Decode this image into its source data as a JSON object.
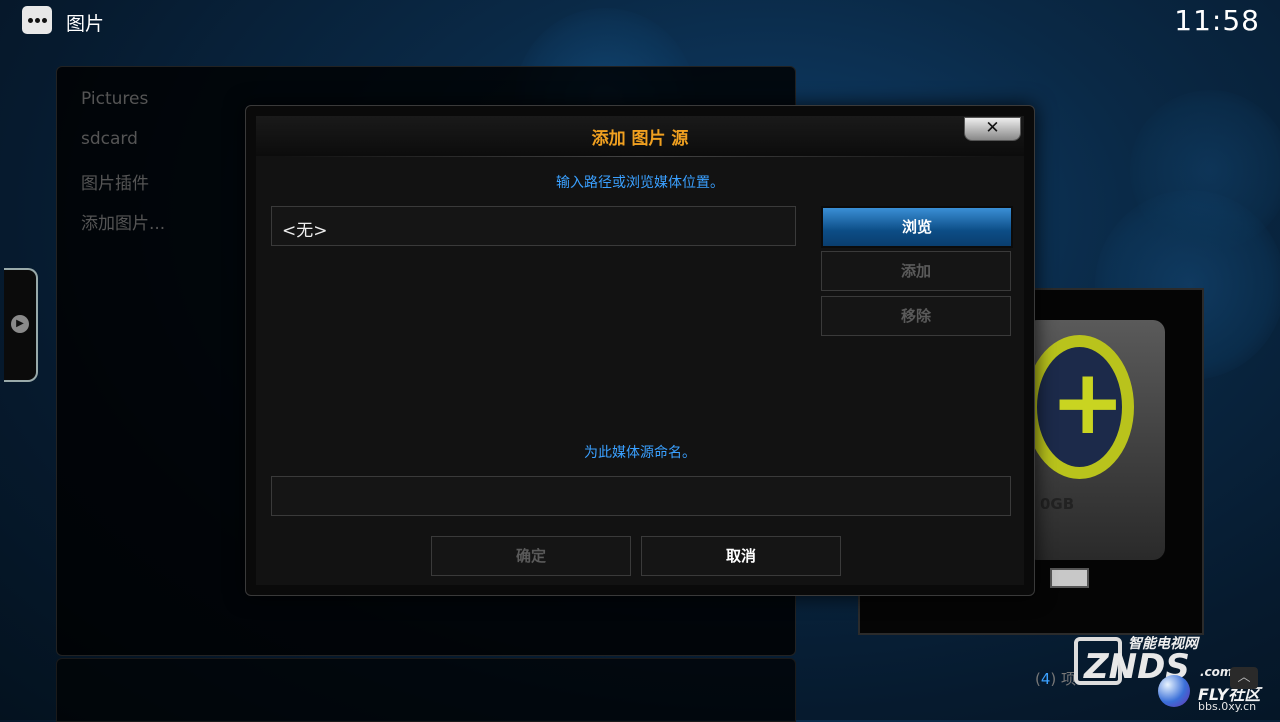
{
  "topbar": {
    "title": "图片",
    "clock": "11:58"
  },
  "left_list": {
    "items": [
      "Pictures",
      "sdcard",
      "图片插件",
      "添加图片..."
    ]
  },
  "thumbnail": {
    "drive_label": "0GB"
  },
  "counter": {
    "num": "4",
    "text": ") 项"
  },
  "watermark": {
    "top": "智能电视网",
    "logo": "ZNDS",
    "com": ".com",
    "fly": "FLY社区",
    "url": "bbs.0xy.cn"
  },
  "dialog": {
    "title": "添加 图片 源",
    "close_symbol": "✕",
    "path_hint": "输入路径或浏览媒体位置。",
    "path_value": "<无>",
    "browse_label": "浏览",
    "add_label": "添加",
    "remove_label": "移除",
    "name_hint": "为此媒体源命名。",
    "name_value": "",
    "ok_label": "确定",
    "cancel_label": "取消"
  },
  "colors": {
    "accent": "#3aa0ff",
    "title": "#f0a020",
    "focus": "#0c4d86"
  }
}
